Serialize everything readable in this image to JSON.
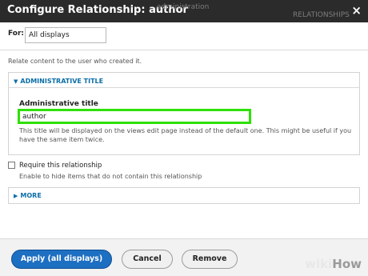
{
  "dialog": {
    "title": "Configure Relationship: author",
    "background_text_1": "administration",
    "background_text_2": "RELATIONSHIPS",
    "close_glyph": "×"
  },
  "for": {
    "label": "For:",
    "value": "All displays"
  },
  "description": "Relate content to the user who created it.",
  "administrative_title_section": {
    "legend": "ADMINISTRATIVE TITLE",
    "field_label": "Administrative title",
    "field_value": "author",
    "help_text": "This title will be displayed on the views edit page instead of the default one. This might be useful if you have the same item twice."
  },
  "require": {
    "label": "Require this relationship",
    "description": "Enable to hide items that do not contain this relationship",
    "checked": false
  },
  "more_section": {
    "legend": "MORE"
  },
  "footer": {
    "apply_label": "Apply (all displays)",
    "cancel_label": "Cancel",
    "remove_label": "Remove"
  },
  "watermark": {
    "wiki": "wiki",
    "how": "How"
  },
  "colors": {
    "titlebar": "#2b2b2b",
    "link_blue": "#0b6ea8",
    "primary_button": "#1d6fc2",
    "highlight_green": "#2ee000"
  },
  "icons": {
    "close": "close-icon",
    "section_expanded": "triangle-down-icon",
    "section_collapsed": "triangle-right-icon"
  }
}
